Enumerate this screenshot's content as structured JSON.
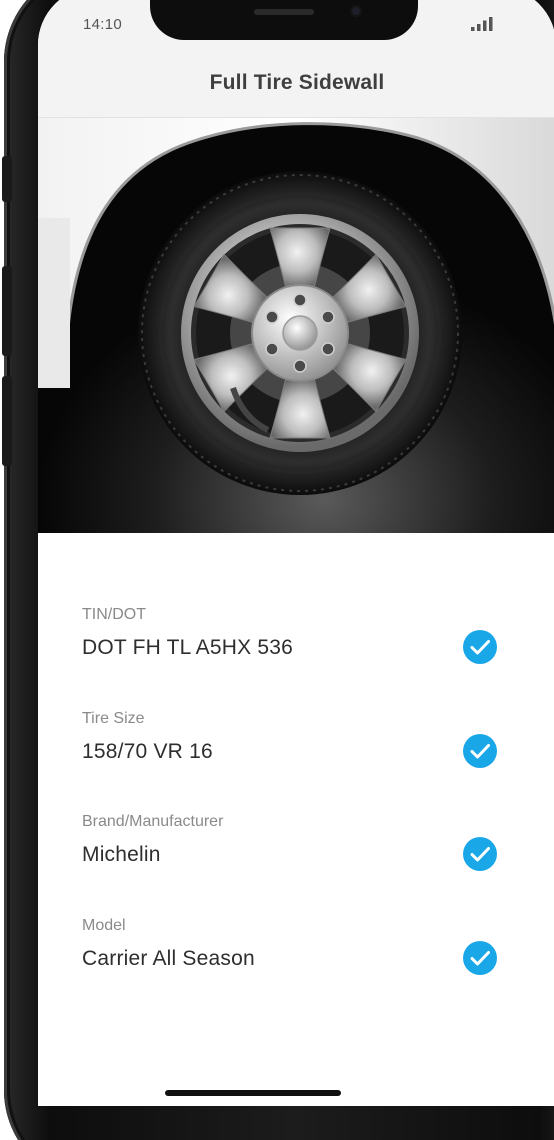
{
  "status_bar": {
    "time": "14:10",
    "signal_icon": "cellular-signal-icon"
  },
  "header": {
    "title": "Full Tire Sidewall"
  },
  "photo": {
    "subject": "tire-wheel-photo"
  },
  "fields": [
    {
      "label": "TIN/DOT",
      "value": "DOT FH TL A5HX 536",
      "icon": "check-circle-icon"
    },
    {
      "label": "Tire Size",
      "value": "158/70 VR 16",
      "icon": "check-circle-icon"
    },
    {
      "label": "Brand/Manufacturer",
      "value": "Michelin",
      "icon": "check-circle-icon"
    },
    {
      "label": "Model",
      "value": "Carrier All Season",
      "icon": "check-circle-icon"
    }
  ],
  "colors": {
    "check": "#1aa7e8",
    "header_bg": "#f3f3f3",
    "title": "#3f3f3f",
    "label": "#8a8a8a",
    "value": "#2e2e2e"
  }
}
